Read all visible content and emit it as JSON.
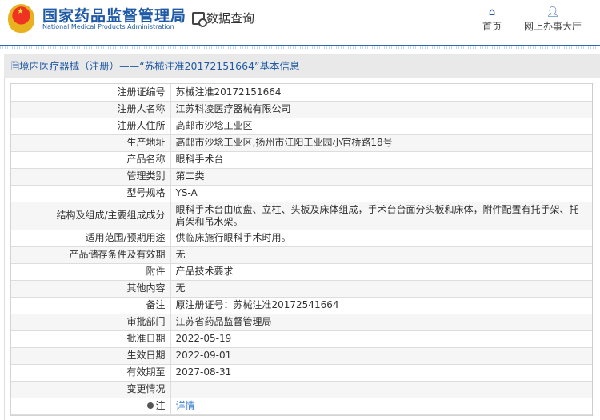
{
  "header": {
    "logo_cn": "国家药品监督管理局",
    "logo_en": "National Medical Products Administration",
    "data_query": "数据查询",
    "nav": [
      {
        "label": "首页",
        "icon": "home-icon"
      },
      {
        "label": "网上办事大厅",
        "icon": "user-icon"
      }
    ]
  },
  "breadcrumb": "境内医疗器械（注册）——“苏械注准20172151664”基本信息",
  "rows": [
    {
      "label": "注册证编号",
      "value": "苏械注准20172151664"
    },
    {
      "label": "注册人名称",
      "value": "江苏科凌医疗器械有限公司"
    },
    {
      "label": "注册人住所",
      "value": "高邮市沙埝工业区"
    },
    {
      "label": "生产地址",
      "value": "高邮市沙埝工业区,扬州市江阳工业园小官桥路18号"
    },
    {
      "label": "产品名称",
      "value": "眼科手术台"
    },
    {
      "label": "管理类别",
      "value": "第二类"
    },
    {
      "label": "型号规格",
      "value": "YS-A"
    },
    {
      "label": "结构及组成/主要组成成分",
      "value": "眼科手术台由底盘、立柱、头板及床体组成，手术台台面分头板和床体，附件配置有托手架、托肩架和吊水架。"
    },
    {
      "label": "适用范围/预期用途",
      "value": "供临床施行眼科手术时用。"
    },
    {
      "label": "产品储存条件及有效期",
      "value": "无"
    },
    {
      "label": "附件",
      "value": "产品技术要求"
    },
    {
      "label": "其他内容",
      "value": "无"
    },
    {
      "label": "备注",
      "value": "原注册证号：苏械注准20172541664"
    },
    {
      "label": "审批部门",
      "value": "江苏省药品监督管理局"
    },
    {
      "label": "批准日期",
      "value": "2022-05-19"
    },
    {
      "label": "生效日期",
      "value": "2022-09-01"
    },
    {
      "label": "有效期至",
      "value": "2027-08-31"
    },
    {
      "label": "变更情况",
      "value": ""
    }
  ],
  "note": {
    "label": "注",
    "link": "详情"
  }
}
